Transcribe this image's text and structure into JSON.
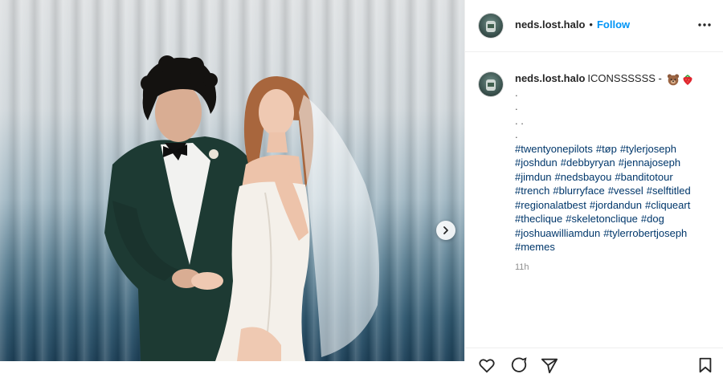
{
  "header": {
    "username": "neds.lost.halo",
    "separator": "•",
    "follow_label": "Follow",
    "more_icon": "more-horizontal-icon"
  },
  "caption": {
    "username": "neds.lost.halo",
    "text": "ICONSSSSSS -",
    "emojis": [
      "bear-face-emoji",
      "strawberry-emoji"
    ],
    "dot_lines": [
      ".",
      ".",
      ". .",
      "."
    ],
    "hashtags": [
      "#twentyonepilots",
      "#tøp",
      "#tylerjoseph",
      "#joshdun",
      "#debbyryan",
      "#jennajoseph",
      "#jimdun",
      "#nedsbayou",
      "#banditotour",
      "#trench",
      "#blurryface",
      "#vessel",
      "#selftitled",
      "#regionalatbest",
      "#jordandun",
      "#cliqueart",
      "#theclique",
      "#skeletonclique",
      "#dog",
      "#joshuawilliamdun",
      "#tylerrobertjoseph",
      "#memes"
    ],
    "time": "11h"
  },
  "photo": {
    "next_icon": "chevron-right-icon"
  },
  "actions": [
    "heart-icon",
    "comment-icon",
    "share-icon",
    "bookmark-icon"
  ],
  "colors": {
    "link": "#00376b",
    "follow": "#0095f6",
    "text": "#262626",
    "muted": "#8e8e8e"
  }
}
